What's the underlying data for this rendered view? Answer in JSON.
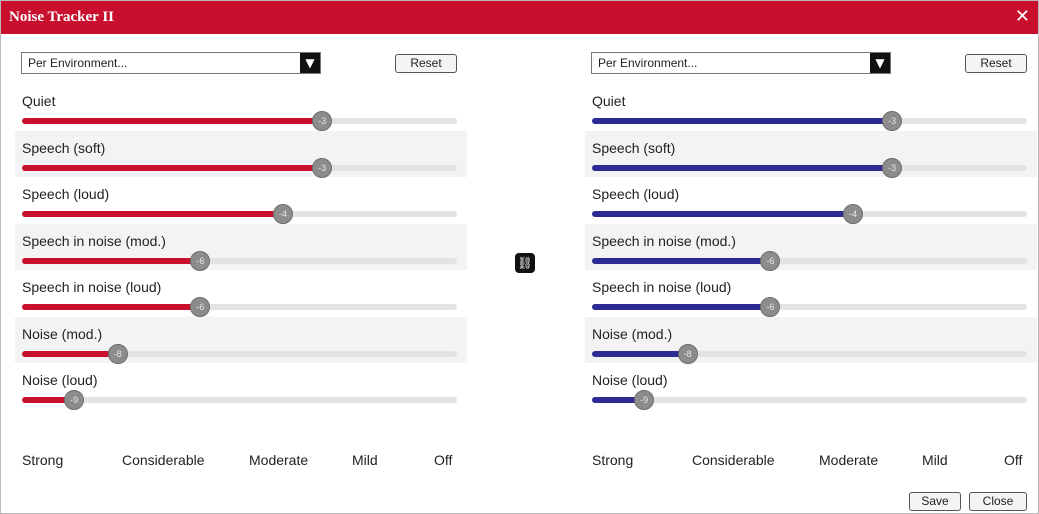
{
  "window": {
    "title": "Noise Tracker II",
    "close_glyph": "✕"
  },
  "sliders": [
    {
      "label": "Quiet",
      "thumb_label": "-3",
      "left": {
        "level": 0.69
      },
      "right": {
        "level": 0.69
      }
    },
    {
      "label": "Speech (soft)",
      "thumb_label": "-3",
      "left": {
        "level": 0.69
      },
      "right": {
        "level": 0.69
      }
    },
    {
      "label": "Speech (loud)",
      "thumb_label": "-4",
      "left": {
        "level": 0.6
      },
      "right": {
        "level": 0.6
      }
    },
    {
      "label": "Speech in noise (mod.)",
      "thumb_label": "-6",
      "left": {
        "level": 0.41
      },
      "right": {
        "level": 0.41
      }
    },
    {
      "label": "Speech in noise (loud)",
      "thumb_label": "-6",
      "left": {
        "level": 0.41
      },
      "right": {
        "level": 0.41
      }
    },
    {
      "label": "Noise (mod.)",
      "thumb_label": "-8",
      "left": {
        "level": 0.22
      },
      "right": {
        "level": 0.22
      }
    },
    {
      "label": "Noise (loud)",
      "thumb_label": "-9",
      "left": {
        "level": 0.12
      },
      "right": {
        "level": 0.12
      }
    }
  ],
  "left": {
    "dropdown_value": "Per Environment...",
    "reset_label": "Reset",
    "scale_labels": [
      "Strong",
      "Considerable",
      "Moderate",
      "Mild",
      "Off"
    ],
    "accent_color": "#c8102e"
  },
  "right": {
    "dropdown_value": "Per Environment...",
    "reset_label": "Reset",
    "scale_labels": [
      "Strong",
      "Considerable",
      "Moderate",
      "Mild",
      "Off"
    ],
    "accent_color": "#2b2b93"
  },
  "link_icon": "link-icon",
  "footer": {
    "save_label": "Save",
    "close_label": "Close"
  }
}
